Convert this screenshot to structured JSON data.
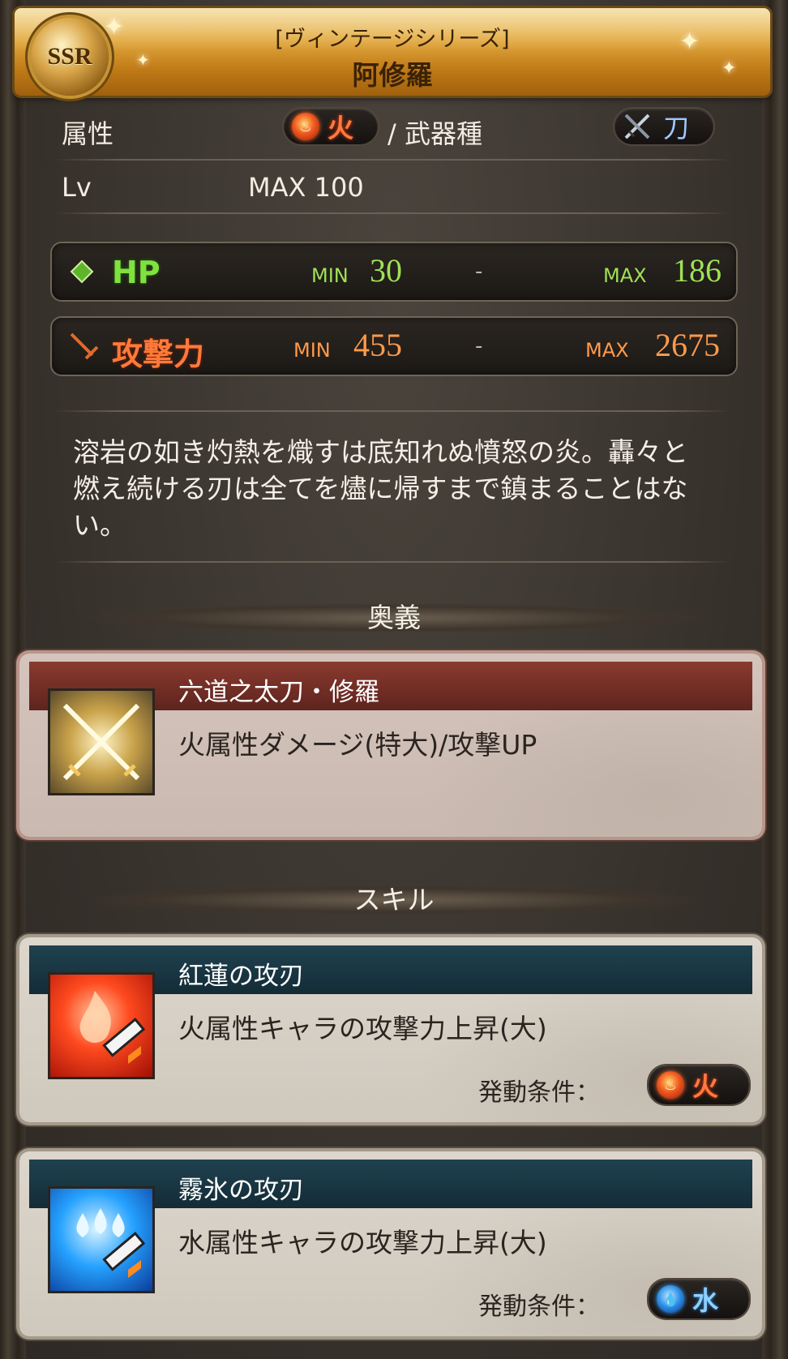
{
  "header": {
    "rarity": "SSR",
    "series": "[ヴィンテージシリーズ]",
    "name": "阿修羅"
  },
  "attributes": {
    "label": "属性",
    "element": "火",
    "separator": "/ 武器種",
    "weapon_type": "刀"
  },
  "level": {
    "label": "Lv",
    "value": "MAX 100"
  },
  "stats": {
    "hp": {
      "label": "HP",
      "min_label": "MIN",
      "min": "30",
      "dash": "-",
      "max_label": "MAX",
      "max": "186"
    },
    "atk": {
      "label": "攻撃力",
      "min_label": "MIN",
      "min": "455",
      "dash": "-",
      "max_label": "MAX",
      "max": "2675"
    }
  },
  "description": "溶岩の如き灼熱を熾すは底知れぬ憤怒の炎。轟々と燃え続ける刃は全てを燼に帰すまで鎮まることはない。",
  "ougi": {
    "section_title": "奥義",
    "name": "六道之太刀・修羅",
    "effect": "火属性ダメージ(特大)/攻撃UP"
  },
  "skills": {
    "section_title": "スキル",
    "items": [
      {
        "name": "紅蓮の攻刃",
        "effect": "火属性キャラの攻撃力上昇(大)",
        "cond_label": "発動条件：",
        "cond_element": "火",
        "icon": "fire-attack-skill-icon"
      },
      {
        "name": "霧氷の攻刃",
        "effect": "水属性キャラの攻撃力上昇(大)",
        "cond_label": "発動条件：",
        "cond_element": "水",
        "icon": "water-attack-skill-icon"
      }
    ]
  },
  "colors": {
    "hp": "#9fe155",
    "atk": "#ff9a4a",
    "fire": "#ff7a42",
    "water": "#8fd0ff",
    "gold": "#e3aa3f"
  }
}
